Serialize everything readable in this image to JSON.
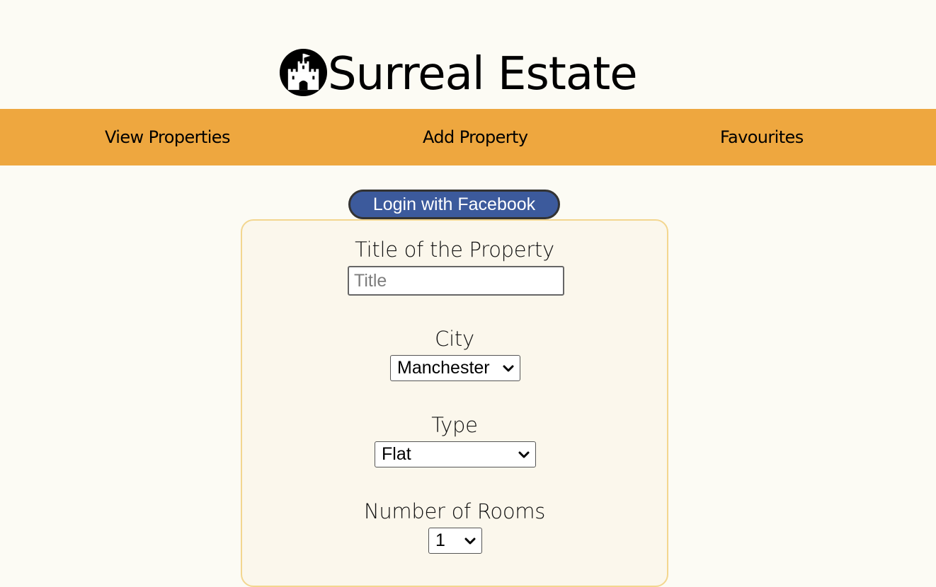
{
  "header": {
    "logo_icon": "castle-icon",
    "title": "Surreal Estate"
  },
  "nav": {
    "items": [
      {
        "label": "View Properties"
      },
      {
        "label": "Add Property"
      },
      {
        "label": "Favourites"
      }
    ]
  },
  "auth": {
    "facebook_label": "Login with Facebook"
  },
  "form": {
    "title_label": "Title of the Property",
    "title_placeholder": "Title",
    "title_value": "",
    "city_label": "City",
    "city_value": "Manchester",
    "type_label": "Type",
    "type_value": "Flat",
    "rooms_label": "Number of Rooms",
    "rooms_value": "1"
  },
  "colors": {
    "background": "#fcfbf4",
    "nav_background": "#eea73f",
    "facebook_blue": "#3c5a9c",
    "card_border": "#f3d68f",
    "card_background": "#fbf7ec"
  }
}
